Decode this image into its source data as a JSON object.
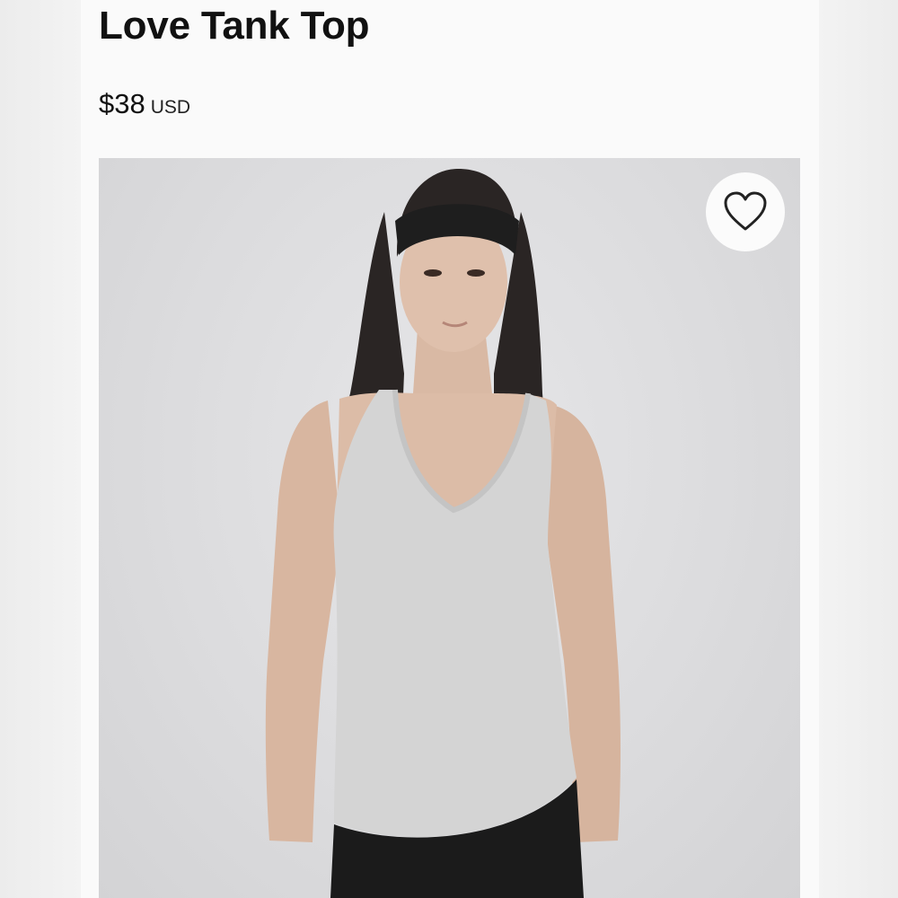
{
  "product": {
    "title": "Love Tank Top",
    "price_amount": "$38",
    "price_currency": "USD"
  },
  "image": {
    "background_color": "#dcdcde",
    "garment_color": "#d4d4d4",
    "headband_color": "#1e1e1e",
    "leggings_color": "#1b1b1b"
  },
  "icons": {
    "wishlist": "heart-outline-icon"
  }
}
